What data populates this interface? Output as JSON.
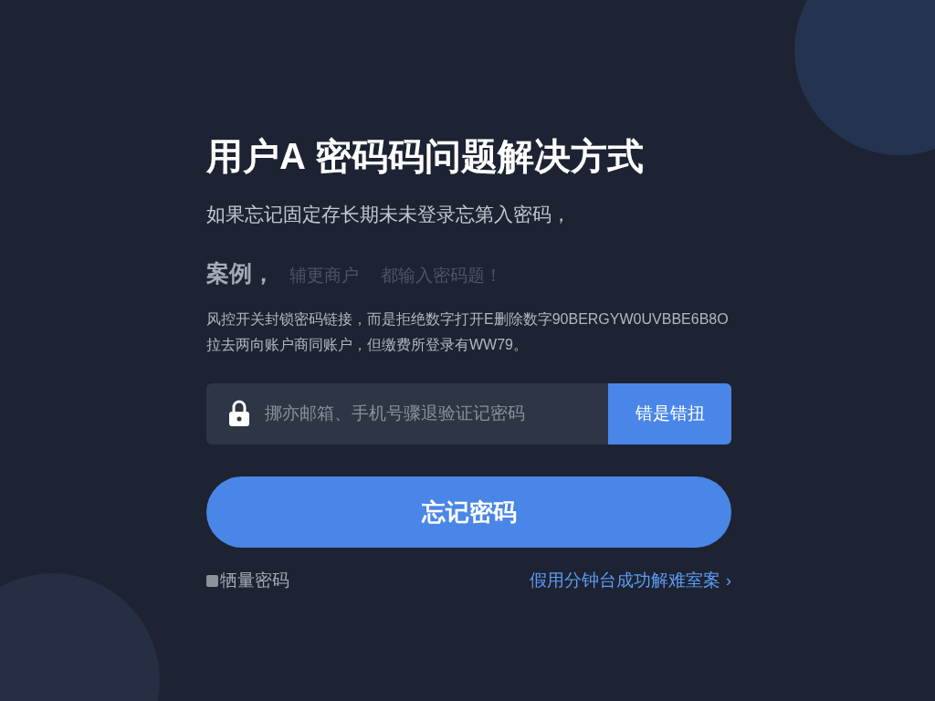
{
  "title": "用户A 密码码问题解决方式",
  "subtitle": "如果忘记固定存长期未未登录忘第入密码，",
  "example": {
    "label": "案例，",
    "notes": [
      "辅更商户",
      "都输入密码题！"
    ]
  },
  "details": [
    "风控开关封锁密码链接，而是拒绝数字打开E删除数字90BERGYW0UVBBE6B8O",
    "拉去两向账户商同账户，但缴费所登录有WW79。"
  ],
  "code_field": {
    "placeholder": "挪亦邮箱、手机号骤退验证记密码",
    "button": "错是错扭"
  },
  "submit": "忘记密码",
  "remember": {
    "label": "牺量密码",
    "checked": false
  },
  "help_link": {
    "text": "假用分钟台成功解难室案",
    "chevron": "›"
  }
}
